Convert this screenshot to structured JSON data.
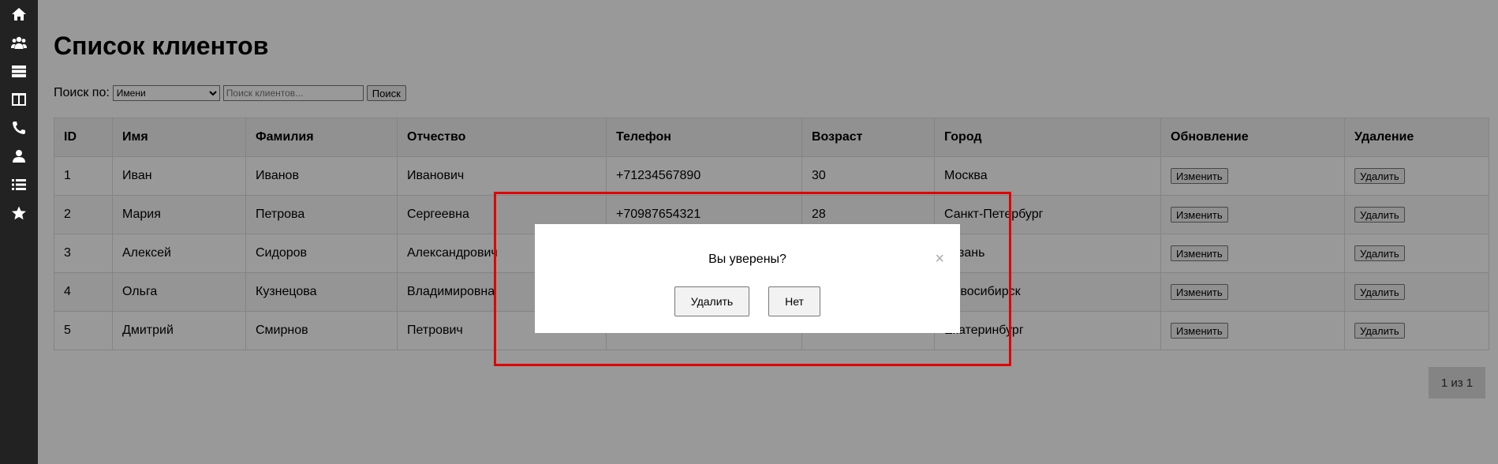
{
  "sidebar": {
    "items": [
      {
        "icon": "home-icon"
      },
      {
        "icon": "users-icon"
      },
      {
        "icon": "servers-icon"
      },
      {
        "icon": "columns-icon"
      },
      {
        "icon": "phone-icon"
      },
      {
        "icon": "user-icon"
      },
      {
        "icon": "list-icon"
      },
      {
        "icon": "star-icon"
      }
    ]
  },
  "page": {
    "title": "Список клиентов"
  },
  "search": {
    "label": "Поиск по:",
    "selected": "Имени",
    "placeholder": "Поиск клиентов...",
    "button": "Поиск"
  },
  "table": {
    "headers": [
      "ID",
      "Имя",
      "Фамилия",
      "Отчество",
      "Телефон",
      "Возраст",
      "Город",
      "Обновление",
      "Удаление"
    ],
    "edit_label": "Изменить",
    "delete_label": "Удалить",
    "rows": [
      {
        "id": "1",
        "first": "Иван",
        "last": "Иванов",
        "middle": "Иванович",
        "phone": "+71234567890",
        "age": "30",
        "city": "Москва"
      },
      {
        "id": "2",
        "first": "Мария",
        "last": "Петрова",
        "middle": "Сергеевна",
        "phone": "+70987654321",
        "age": "28",
        "city": "Санкт-Петербург"
      },
      {
        "id": "3",
        "first": "Алексей",
        "last": "Сидоров",
        "middle": "Александрович",
        "phone": "",
        "age": "",
        "city": "Казань"
      },
      {
        "id": "4",
        "first": "Ольга",
        "last": "Кузнецова",
        "middle": "Владимировна",
        "phone": "",
        "age": "",
        "city": "Новосибирск"
      },
      {
        "id": "5",
        "first": "Дмитрий",
        "last": "Смирнов",
        "middle": "Петрович",
        "phone": "",
        "age": "",
        "city": "Екатеринбург"
      }
    ]
  },
  "pagination": {
    "text": "1 из 1"
  },
  "modal": {
    "question": "Вы уверены?",
    "close": "×",
    "confirm": "Удалить",
    "cancel": "Нет"
  },
  "colors": {
    "sidebar_bg": "#222222",
    "overlay": "rgba(0,0,0,0.4)",
    "highlight": "#e00000"
  }
}
